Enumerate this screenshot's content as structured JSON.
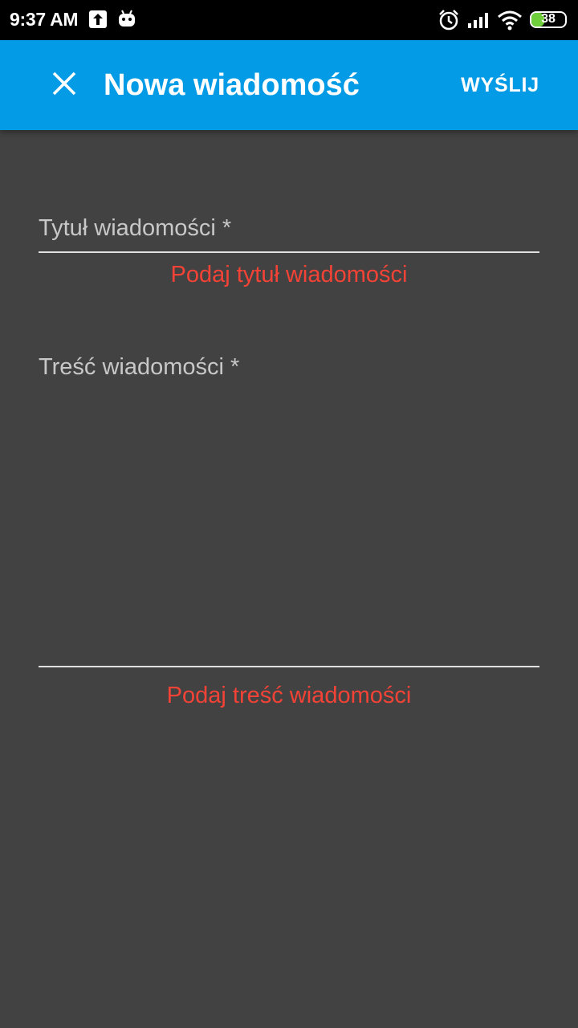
{
  "status_bar": {
    "time": "9:37 AM",
    "battery_level": "38",
    "battery_fraction": 0.38,
    "icons": [
      "upload-icon",
      "android-icon",
      "alarm-icon",
      "signal-icon",
      "wifi-icon",
      "battery-icon"
    ]
  },
  "app_bar": {
    "title": "Nowa wiadomość",
    "send_label": "WYŚLIJ",
    "close_icon": "close-icon",
    "color": "#039be5"
  },
  "form": {
    "title_field": {
      "label": "Tytuł wiadomości *",
      "value": "",
      "error": "Podaj tytuł wiadomości"
    },
    "body_field": {
      "label": "Treść wiadomości *",
      "value": "",
      "error": "Podaj treść wiadomości"
    }
  },
  "colors": {
    "background": "#424242",
    "error": "#f44336",
    "accent": "#039be5"
  }
}
